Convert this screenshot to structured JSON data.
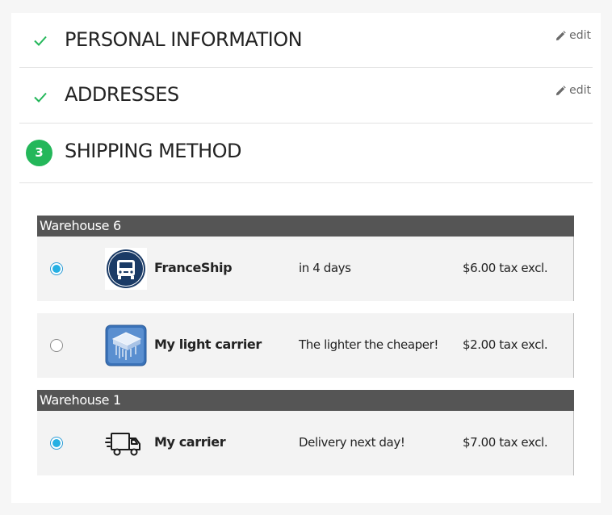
{
  "steps": {
    "personal": {
      "title": "PERSONAL INFORMATION",
      "edit_label": "edit",
      "status": "complete"
    },
    "addresses": {
      "title": "ADDRESSES",
      "edit_label": "edit",
      "status": "complete"
    },
    "shipping": {
      "number": "3",
      "title": "SHIPPING METHOD",
      "status": "current"
    }
  },
  "warehouses": [
    {
      "name": "Warehouse 6",
      "carriers": [
        {
          "name": "FranceShip",
          "delay": "in 4 days",
          "price": "$6.00 tax excl.",
          "selected": true,
          "logo": "bus-badge-icon"
        },
        {
          "name": "My light carrier",
          "delay": "The lighter the cheaper!",
          "price": "$2.00 tax excl.",
          "selected": false,
          "logo": "light-carrier-logo-icon"
        }
      ]
    },
    {
      "name": "Warehouse 1",
      "carriers": [
        {
          "name": "My carrier",
          "delay": "Delivery next day!",
          "price": "$7.00 tax excl.",
          "selected": true,
          "logo": "delivery-truck-icon"
        }
      ]
    }
  ],
  "colors": {
    "check": "#24b75a",
    "step_badge": "#24b75a",
    "warehouse_header": "#555555",
    "radio_selected": "#25b0e3"
  }
}
